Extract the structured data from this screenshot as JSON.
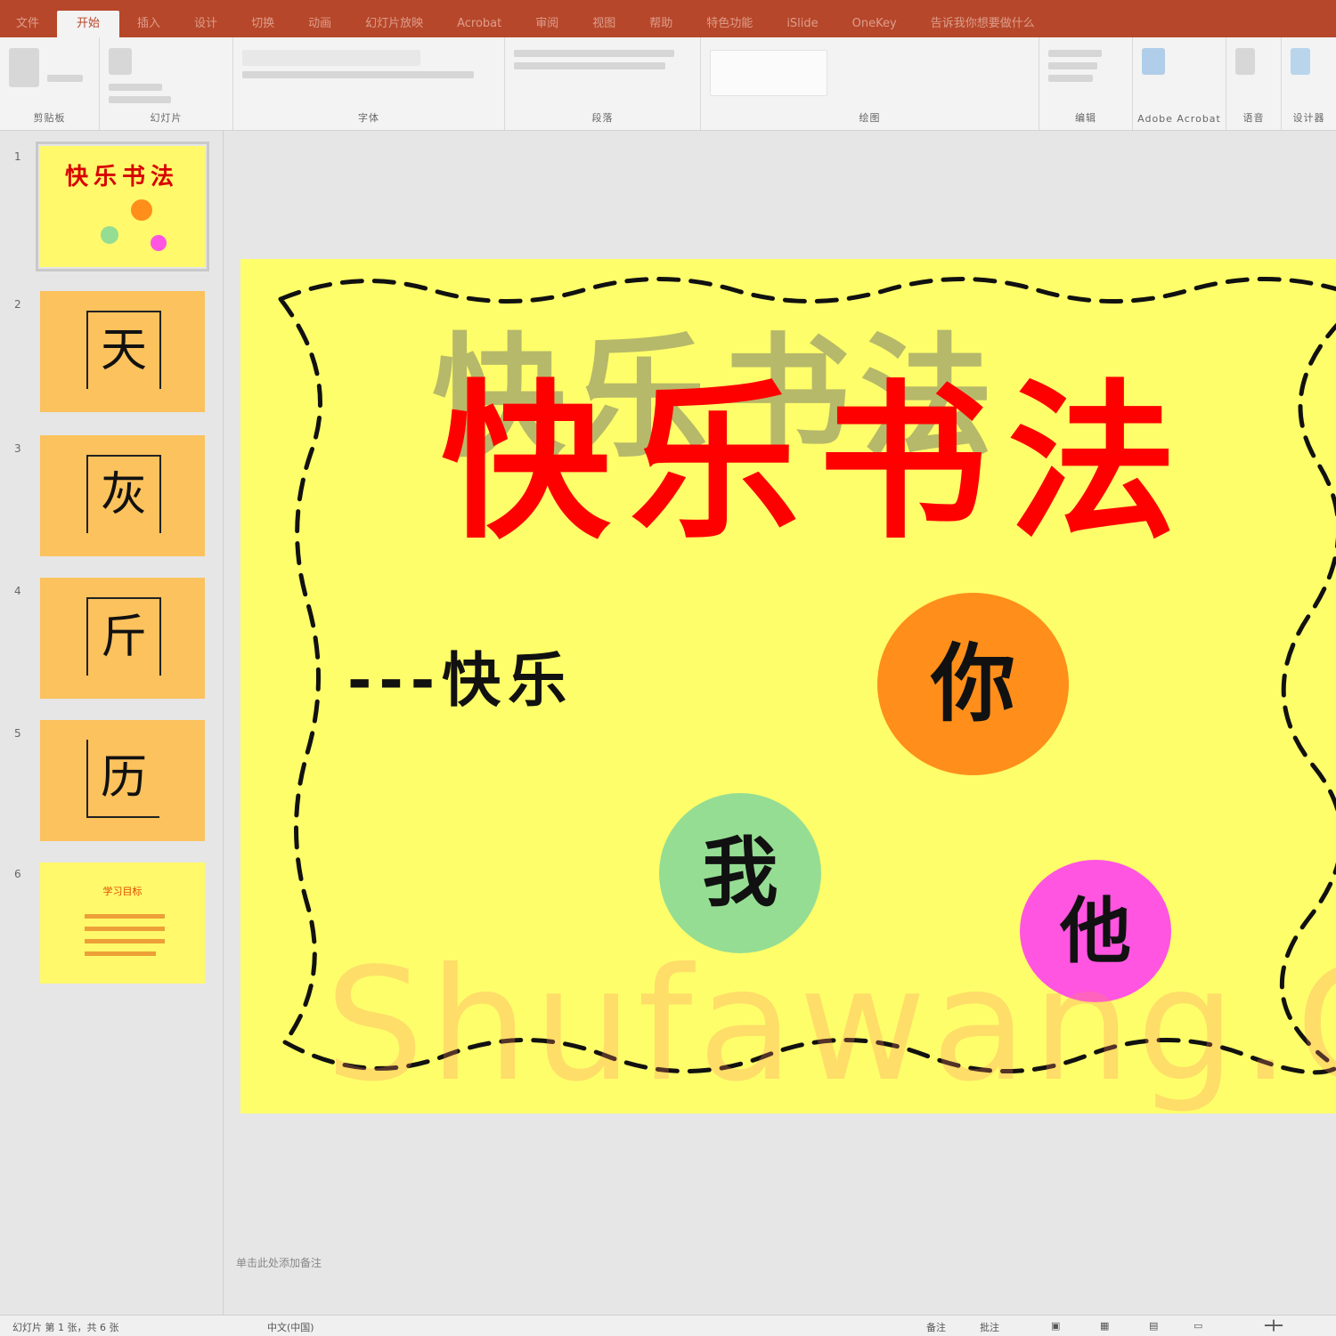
{
  "tabs": [
    {
      "label": "文件"
    },
    {
      "label": "开始"
    },
    {
      "label": "插入"
    },
    {
      "label": "设计"
    },
    {
      "label": "切换"
    },
    {
      "label": "动画"
    },
    {
      "label": "幻灯片放映"
    },
    {
      "label": "Acrobat"
    },
    {
      "label": "审阅"
    },
    {
      "label": "视图"
    },
    {
      "label": "帮助"
    },
    {
      "label": "特色功能"
    },
    {
      "label": "iSlide"
    },
    {
      "label": "OneKey"
    },
    {
      "label": "告诉我你想要做什么"
    }
  ],
  "ribbon_groups": [
    {
      "label": "剪贴板"
    },
    {
      "label": "幻灯片"
    },
    {
      "label": "字体"
    },
    {
      "label": "段落"
    },
    {
      "label": "绘图"
    },
    {
      "label": "编辑"
    },
    {
      "label": "Adobe Acrobat"
    },
    {
      "label": "语音"
    },
    {
      "label": "设计器"
    }
  ],
  "thumbnails": [
    {
      "num": "1",
      "title": "快乐书法"
    },
    {
      "num": "2",
      "char": "天"
    },
    {
      "num": "3",
      "char": "灰"
    },
    {
      "num": "4",
      "char": "斤"
    },
    {
      "num": "5",
      "char": "历"
    },
    {
      "num": "6",
      "title": "学习目标"
    }
  ],
  "slide": {
    "title": "快乐书法",
    "title_shadow": "快乐书法",
    "subtitle": "---快乐",
    "circles": [
      {
        "text": "你",
        "color": "#ff8f1a"
      },
      {
        "text": "我",
        "color": "#95dd93"
      },
      {
        "text": "他",
        "color": "#ff55e0"
      }
    ],
    "watermark": "Shufawang.CN"
  },
  "notes_hint": "单击此处添加备注",
  "status": {
    "slide_info": "幻灯片 第 1 张，共 6 张",
    "language": "中文(中国)",
    "notes": "备注",
    "comments": "批注"
  },
  "colors": {
    "accent": "#b7472a",
    "slide_bg": "#fefe6a",
    "title": "#ff0000",
    "thumb_orange": "#fbc25d"
  }
}
